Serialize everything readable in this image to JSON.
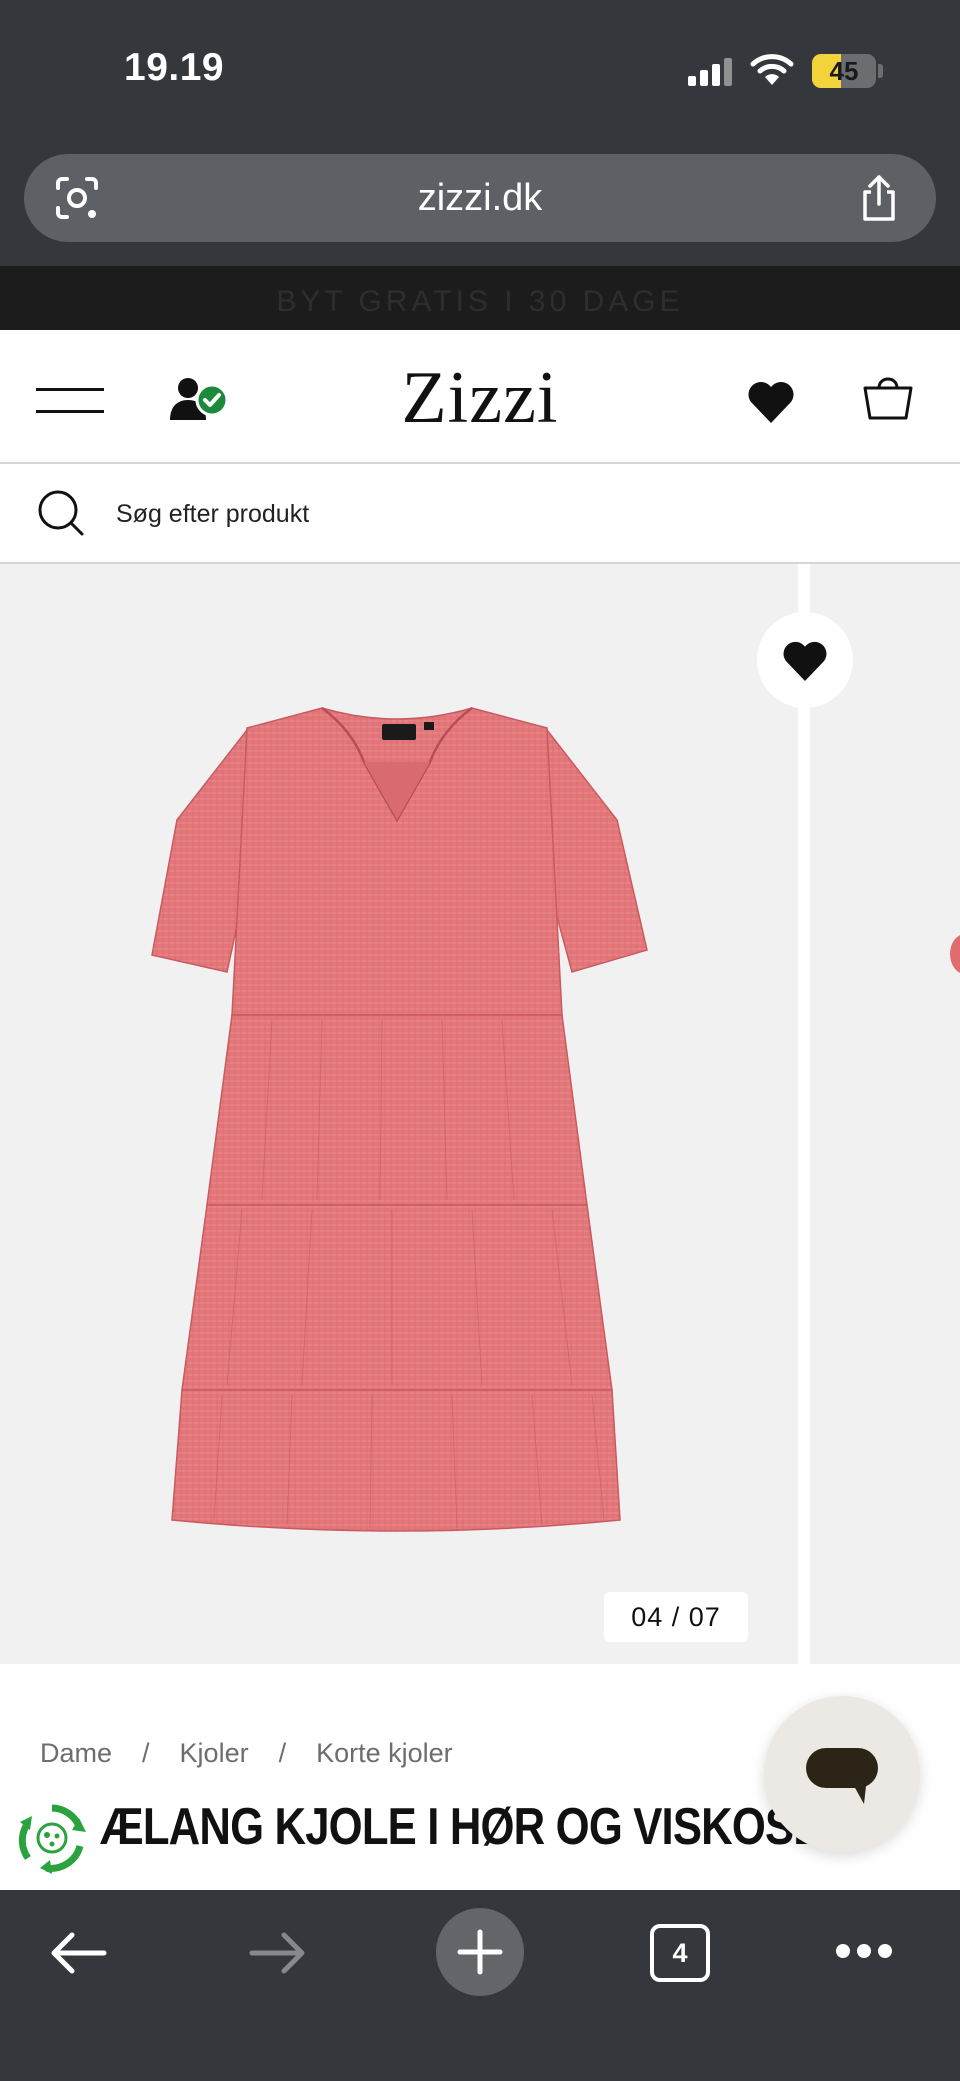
{
  "status_bar": {
    "time": "19.19",
    "battery_level": "45",
    "battery_percent": 45,
    "signal_icon": "signal-bars-icon",
    "wifi_icon": "wifi-icon"
  },
  "browser": {
    "url": "zizzi.dk",
    "lens_icon": "camera-lens-icon",
    "share_icon": "share-icon",
    "open_tabs": "4"
  },
  "promo": {
    "text": "BYT GRATIS I 30 DAGE"
  },
  "header": {
    "logo": "Zizzi",
    "menu_icon": "hamburger-menu-icon",
    "account_icon": "account-verified-icon",
    "wishlist_icon": "heart-icon",
    "bag_icon": "shopping-bag-icon"
  },
  "search": {
    "placeholder": "Søg efter produkt"
  },
  "gallery": {
    "counter": "04  /  07",
    "current_slide": 4,
    "total_slides": 7
  },
  "product": {
    "breadcrumb": [
      "Dame",
      "Kjoler",
      "Korte kjoler"
    ],
    "title": "ÆLANG KJOLE I HØR OG VISKOSE I",
    "eco_badge_icon": "eco-recycle-icon",
    "chat_icon": "chat-bubble-icon"
  },
  "colors": {
    "chrome": "#34373b",
    "dress": "#e3767a",
    "check_green": "#1b8a3a"
  }
}
